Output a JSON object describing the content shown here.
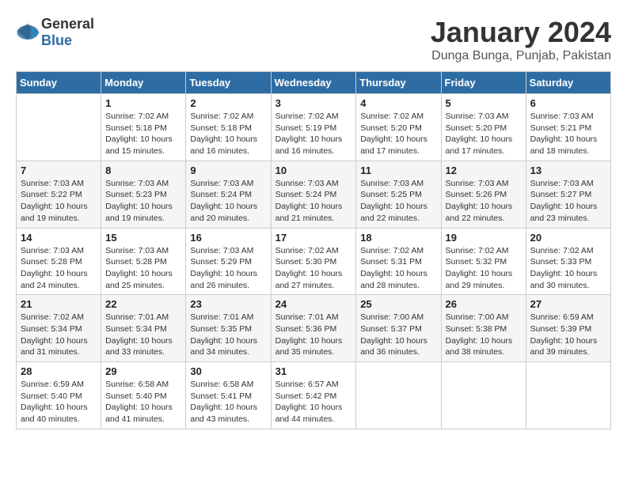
{
  "header": {
    "logo_general": "General",
    "logo_blue": "Blue",
    "month": "January 2024",
    "location": "Dunga Bunga, Punjab, Pakistan"
  },
  "days_of_week": [
    "Sunday",
    "Monday",
    "Tuesday",
    "Wednesday",
    "Thursday",
    "Friday",
    "Saturday"
  ],
  "weeks": [
    [
      {
        "num": "",
        "sunrise": "",
        "sunset": "",
        "daylight": ""
      },
      {
        "num": "1",
        "sunrise": "Sunrise: 7:02 AM",
        "sunset": "Sunset: 5:18 PM",
        "daylight": "Daylight: 10 hours and 15 minutes."
      },
      {
        "num": "2",
        "sunrise": "Sunrise: 7:02 AM",
        "sunset": "Sunset: 5:18 PM",
        "daylight": "Daylight: 10 hours and 16 minutes."
      },
      {
        "num": "3",
        "sunrise": "Sunrise: 7:02 AM",
        "sunset": "Sunset: 5:19 PM",
        "daylight": "Daylight: 10 hours and 16 minutes."
      },
      {
        "num": "4",
        "sunrise": "Sunrise: 7:02 AM",
        "sunset": "Sunset: 5:20 PM",
        "daylight": "Daylight: 10 hours and 17 minutes."
      },
      {
        "num": "5",
        "sunrise": "Sunrise: 7:03 AM",
        "sunset": "Sunset: 5:20 PM",
        "daylight": "Daylight: 10 hours and 17 minutes."
      },
      {
        "num": "6",
        "sunrise": "Sunrise: 7:03 AM",
        "sunset": "Sunset: 5:21 PM",
        "daylight": "Daylight: 10 hours and 18 minutes."
      }
    ],
    [
      {
        "num": "7",
        "sunrise": "Sunrise: 7:03 AM",
        "sunset": "Sunset: 5:22 PM",
        "daylight": "Daylight: 10 hours and 19 minutes."
      },
      {
        "num": "8",
        "sunrise": "Sunrise: 7:03 AM",
        "sunset": "Sunset: 5:23 PM",
        "daylight": "Daylight: 10 hours and 19 minutes."
      },
      {
        "num": "9",
        "sunrise": "Sunrise: 7:03 AM",
        "sunset": "Sunset: 5:24 PM",
        "daylight": "Daylight: 10 hours and 20 minutes."
      },
      {
        "num": "10",
        "sunrise": "Sunrise: 7:03 AM",
        "sunset": "Sunset: 5:24 PM",
        "daylight": "Daylight: 10 hours and 21 minutes."
      },
      {
        "num": "11",
        "sunrise": "Sunrise: 7:03 AM",
        "sunset": "Sunset: 5:25 PM",
        "daylight": "Daylight: 10 hours and 22 minutes."
      },
      {
        "num": "12",
        "sunrise": "Sunrise: 7:03 AM",
        "sunset": "Sunset: 5:26 PM",
        "daylight": "Daylight: 10 hours and 22 minutes."
      },
      {
        "num": "13",
        "sunrise": "Sunrise: 7:03 AM",
        "sunset": "Sunset: 5:27 PM",
        "daylight": "Daylight: 10 hours and 23 minutes."
      }
    ],
    [
      {
        "num": "14",
        "sunrise": "Sunrise: 7:03 AM",
        "sunset": "Sunset: 5:28 PM",
        "daylight": "Daylight: 10 hours and 24 minutes."
      },
      {
        "num": "15",
        "sunrise": "Sunrise: 7:03 AM",
        "sunset": "Sunset: 5:28 PM",
        "daylight": "Daylight: 10 hours and 25 minutes."
      },
      {
        "num": "16",
        "sunrise": "Sunrise: 7:03 AM",
        "sunset": "Sunset: 5:29 PM",
        "daylight": "Daylight: 10 hours and 26 minutes."
      },
      {
        "num": "17",
        "sunrise": "Sunrise: 7:02 AM",
        "sunset": "Sunset: 5:30 PM",
        "daylight": "Daylight: 10 hours and 27 minutes."
      },
      {
        "num": "18",
        "sunrise": "Sunrise: 7:02 AM",
        "sunset": "Sunset: 5:31 PM",
        "daylight": "Daylight: 10 hours and 28 minutes."
      },
      {
        "num": "19",
        "sunrise": "Sunrise: 7:02 AM",
        "sunset": "Sunset: 5:32 PM",
        "daylight": "Daylight: 10 hours and 29 minutes."
      },
      {
        "num": "20",
        "sunrise": "Sunrise: 7:02 AM",
        "sunset": "Sunset: 5:33 PM",
        "daylight": "Daylight: 10 hours and 30 minutes."
      }
    ],
    [
      {
        "num": "21",
        "sunrise": "Sunrise: 7:02 AM",
        "sunset": "Sunset: 5:34 PM",
        "daylight": "Daylight: 10 hours and 31 minutes."
      },
      {
        "num": "22",
        "sunrise": "Sunrise: 7:01 AM",
        "sunset": "Sunset: 5:34 PM",
        "daylight": "Daylight: 10 hours and 33 minutes."
      },
      {
        "num": "23",
        "sunrise": "Sunrise: 7:01 AM",
        "sunset": "Sunset: 5:35 PM",
        "daylight": "Daylight: 10 hours and 34 minutes."
      },
      {
        "num": "24",
        "sunrise": "Sunrise: 7:01 AM",
        "sunset": "Sunset: 5:36 PM",
        "daylight": "Daylight: 10 hours and 35 minutes."
      },
      {
        "num": "25",
        "sunrise": "Sunrise: 7:00 AM",
        "sunset": "Sunset: 5:37 PM",
        "daylight": "Daylight: 10 hours and 36 minutes."
      },
      {
        "num": "26",
        "sunrise": "Sunrise: 7:00 AM",
        "sunset": "Sunset: 5:38 PM",
        "daylight": "Daylight: 10 hours and 38 minutes."
      },
      {
        "num": "27",
        "sunrise": "Sunrise: 6:59 AM",
        "sunset": "Sunset: 5:39 PM",
        "daylight": "Daylight: 10 hours and 39 minutes."
      }
    ],
    [
      {
        "num": "28",
        "sunrise": "Sunrise: 6:59 AM",
        "sunset": "Sunset: 5:40 PM",
        "daylight": "Daylight: 10 hours and 40 minutes."
      },
      {
        "num": "29",
        "sunrise": "Sunrise: 6:58 AM",
        "sunset": "Sunset: 5:40 PM",
        "daylight": "Daylight: 10 hours and 41 minutes."
      },
      {
        "num": "30",
        "sunrise": "Sunrise: 6:58 AM",
        "sunset": "Sunset: 5:41 PM",
        "daylight": "Daylight: 10 hours and 43 minutes."
      },
      {
        "num": "31",
        "sunrise": "Sunrise: 6:57 AM",
        "sunset": "Sunset: 5:42 PM",
        "daylight": "Daylight: 10 hours and 44 minutes."
      },
      {
        "num": "",
        "sunrise": "",
        "sunset": "",
        "daylight": ""
      },
      {
        "num": "",
        "sunrise": "",
        "sunset": "",
        "daylight": ""
      },
      {
        "num": "",
        "sunrise": "",
        "sunset": "",
        "daylight": ""
      }
    ]
  ]
}
